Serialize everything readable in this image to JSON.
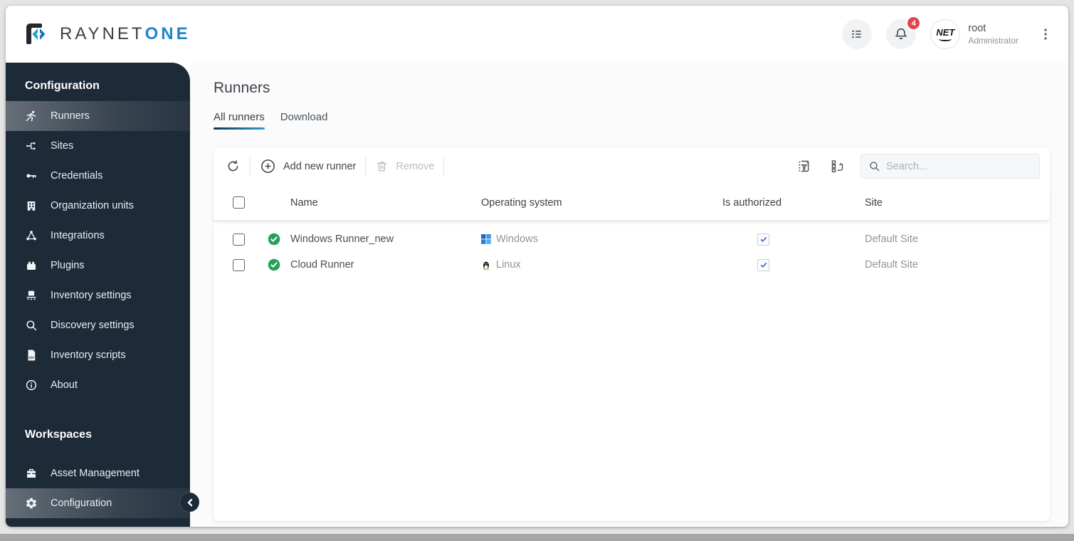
{
  "header": {
    "logo_primary": "RAYNET",
    "logo_accent": "ONE",
    "notification_badge": "4",
    "avatar_text": "NET",
    "user_name": "root",
    "user_role": "Administrator"
  },
  "sidebar": {
    "sections": [
      {
        "title": "Configuration",
        "items": [
          {
            "label": "Runners",
            "selected": true
          },
          {
            "label": "Sites",
            "selected": false
          },
          {
            "label": "Credentials",
            "selected": false
          },
          {
            "label": "Organization units",
            "selected": false
          },
          {
            "label": "Integrations",
            "selected": false
          },
          {
            "label": "Plugins",
            "selected": false
          },
          {
            "label": "Inventory settings",
            "selected": false
          },
          {
            "label": "Discovery settings",
            "selected": false
          },
          {
            "label": "Inventory scripts",
            "selected": false
          },
          {
            "label": "About",
            "selected": false
          }
        ]
      },
      {
        "title": "Workspaces",
        "items": [
          {
            "label": "Asset Management",
            "selected": false
          },
          {
            "label": "Configuration",
            "selected": true
          }
        ]
      }
    ]
  },
  "main": {
    "page_title": "Runners",
    "tabs": [
      {
        "label": "All runners",
        "active": true
      },
      {
        "label": "Download",
        "active": false
      }
    ],
    "toolbar": {
      "add_label": "Add new runner",
      "remove_label": "Remove",
      "search_placeholder": "Search..."
    },
    "table": {
      "columns": {
        "name": "Name",
        "os": "Operating system",
        "authorized": "Is authorized",
        "site": "Site"
      },
      "rows": [
        {
          "status": "online",
          "name": "Windows Runner_new",
          "os": "Windows",
          "authorized": true,
          "site": "Default Site"
        },
        {
          "status": "online",
          "name": "Cloud Runner",
          "os": "Linux",
          "authorized": true,
          "site": "Default Site"
        }
      ]
    }
  },
  "colors": {
    "sidebar_bg": "#1d2a38",
    "accent_blue": "#1d87c9",
    "tab_underline_gradient": [
      "#16314c",
      "#2e9bd6"
    ],
    "status_green": "#27a158",
    "badge_red": "#e2434e",
    "windows_blue": "#2e7cd6",
    "auth_check_blue": "#2f6fd6"
  }
}
